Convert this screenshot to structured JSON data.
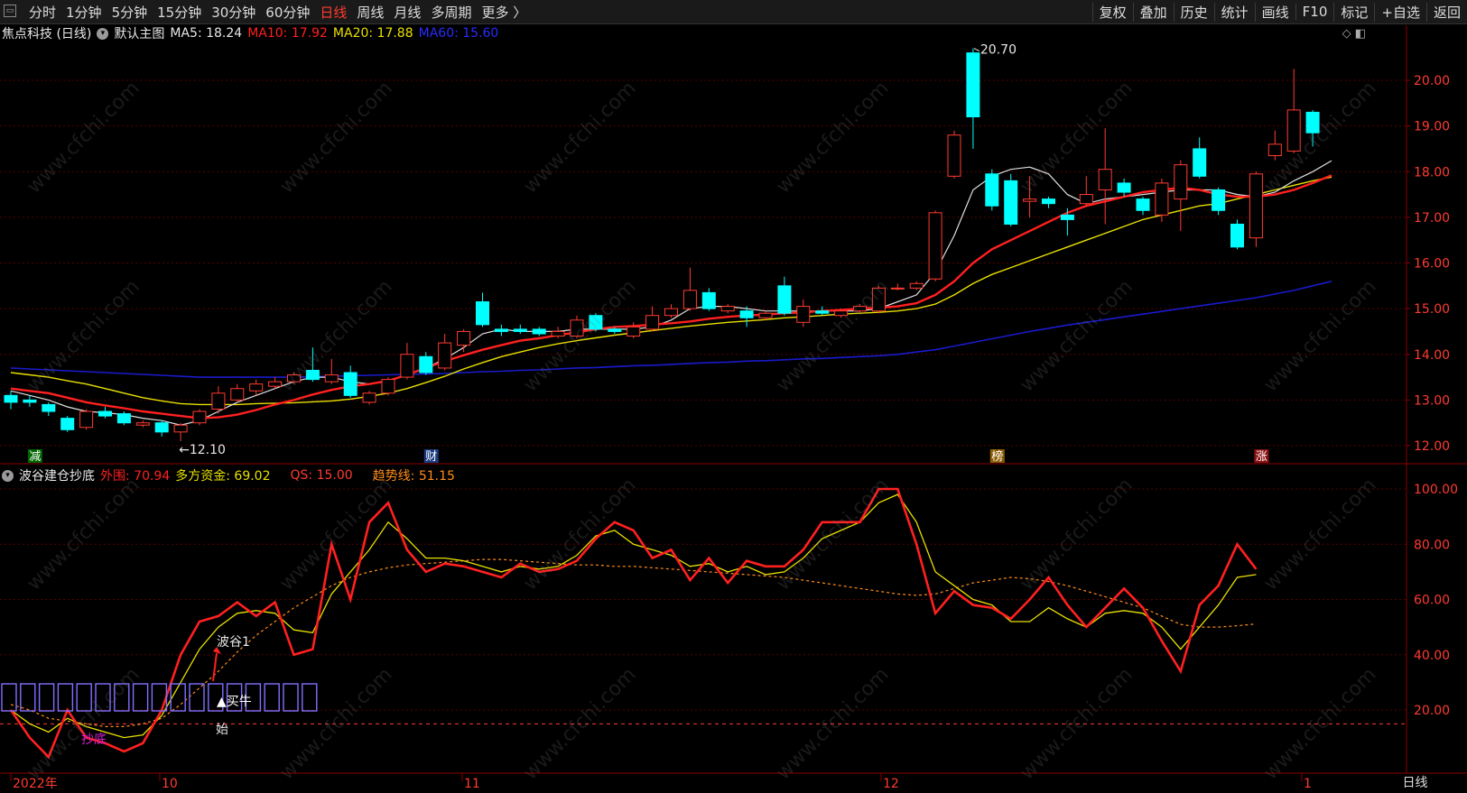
{
  "toolbar": {
    "window_icon": "window-icon",
    "periods": [
      "分时",
      "1分钟",
      "5分钟",
      "15分钟",
      "30分钟",
      "60分钟",
      "日线",
      "周线",
      "月线",
      "多周期",
      "更多 〉"
    ],
    "active_period": "日线",
    "right_tools": [
      "复权",
      "叠加",
      "历史",
      "统计",
      "画线",
      "F10",
      "标记",
      "+自选",
      "返回"
    ]
  },
  "main_chart": {
    "stock_title": "焦点科技 (日线)",
    "template_label": "默认主图",
    "ma5_label": "MA5: 18.24",
    "ma10_label": "MA10: 17.92",
    "ma20_label": "MA20: 17.88",
    "ma60_label": "MA60: 15.60",
    "high_annotation": "20.70",
    "low_annotation": "←12.10",
    "y_ticks": [
      "20.00",
      "19.00",
      "18.00",
      "17.00",
      "16.00",
      "15.00",
      "14.00",
      "13.00",
      "12.00"
    ],
    "event_markers": [
      "减",
      "财",
      "榜",
      "涨"
    ]
  },
  "sub_chart": {
    "indicator_name": "波谷建仓抄底",
    "waiwei_label": "外围: 70.94",
    "duofang_label": "多方资金: 69.02",
    "qs_label": "QS: 15.00",
    "trend_label": "趋势线: 51.15",
    "y_ticks": [
      "100.00",
      "80.00",
      "60.00",
      "40.00",
      "20.00"
    ],
    "annotations": {
      "bogu": "波谷1",
      "buy": "▲买牛",
      "start": "始",
      "chaodi": "抄底"
    }
  },
  "x_axis": {
    "labels": [
      "2022年",
      "10",
      "11",
      "12",
      "1"
    ],
    "period_label": "日线"
  },
  "watermark": "www.cfchi.com",
  "colors": {
    "up": "#ff3b30",
    "down": "#00ffff",
    "ma5": "#e0e0e0",
    "ma10": "#ff2020",
    "ma20": "#e8e000",
    "ma60": "#1a1acc",
    "qs": "#ff3b30",
    "trend": "#ff8c1a"
  },
  "chart_data": [
    {
      "type": "candlestick",
      "title": "焦点科技 (日线)",
      "ylim": [
        11.7,
        21.0
      ],
      "candles": [
        {
          "o": 13.1,
          "c": 12.95,
          "h": 13.2,
          "l": 12.8
        },
        {
          "o": 13.0,
          "c": 12.95,
          "h": 13.1,
          "l": 12.85
        },
        {
          "o": 12.9,
          "c": 12.75,
          "h": 12.95,
          "l": 12.65
        },
        {
          "o": 12.6,
          "c": 12.35,
          "h": 12.65,
          "l": 12.3
        },
        {
          "o": 12.4,
          "c": 12.75,
          "h": 12.8,
          "l": 12.35
        },
        {
          "o": 12.75,
          "c": 12.65,
          "h": 12.85,
          "l": 12.6
        },
        {
          "o": 12.7,
          "c": 12.5,
          "h": 12.75,
          "l": 12.45
        },
        {
          "o": 12.45,
          "c": 12.5,
          "h": 12.55,
          "l": 12.4
        },
        {
          "o": 12.5,
          "c": 12.3,
          "h": 12.55,
          "l": 12.2
        },
        {
          "o": 12.3,
          "c": 12.45,
          "h": 12.5,
          "l": 12.1
        },
        {
          "o": 12.5,
          "c": 12.75,
          "h": 12.8,
          "l": 12.45
        },
        {
          "o": 12.8,
          "c": 13.15,
          "h": 13.3,
          "l": 12.7
        },
        {
          "o": 13.0,
          "c": 13.25,
          "h": 13.35,
          "l": 12.95
        },
        {
          "o": 13.2,
          "c": 13.35,
          "h": 13.45,
          "l": 13.1
        },
        {
          "o": 13.3,
          "c": 13.4,
          "h": 13.5,
          "l": 13.25
        },
        {
          "o": 13.4,
          "c": 13.55,
          "h": 13.6,
          "l": 13.35
        },
        {
          "o": 13.65,
          "c": 13.45,
          "h": 14.15,
          "l": 13.4
        },
        {
          "o": 13.4,
          "c": 13.55,
          "h": 13.9,
          "l": 13.35
        },
        {
          "o": 13.6,
          "c": 13.1,
          "h": 13.75,
          "l": 13.05
        },
        {
          "o": 12.95,
          "c": 13.15,
          "h": 13.2,
          "l": 12.9
        },
        {
          "o": 13.15,
          "c": 13.45,
          "h": 13.5,
          "l": 13.1
        },
        {
          "o": 13.5,
          "c": 14.0,
          "h": 14.25,
          "l": 13.45
        },
        {
          "o": 13.95,
          "c": 13.6,
          "h": 14.05,
          "l": 13.55
        },
        {
          "o": 13.7,
          "c": 14.25,
          "h": 14.45,
          "l": 13.65
        },
        {
          "o": 14.2,
          "c": 14.5,
          "h": 14.55,
          "l": 14.05
        },
        {
          "o": 15.15,
          "c": 14.65,
          "h": 15.35,
          "l": 14.6
        },
        {
          "o": 14.55,
          "c": 14.5,
          "h": 14.65,
          "l": 14.4
        },
        {
          "o": 14.55,
          "c": 14.5,
          "h": 14.65,
          "l": 14.45
        },
        {
          "o": 14.55,
          "c": 14.45,
          "h": 14.6,
          "l": 14.4
        },
        {
          "o": 14.4,
          "c": 14.5,
          "h": 14.6,
          "l": 14.35
        },
        {
          "o": 14.4,
          "c": 14.75,
          "h": 14.85,
          "l": 14.35
        },
        {
          "o": 14.85,
          "c": 14.55,
          "h": 14.9,
          "l": 14.5
        },
        {
          "o": 14.55,
          "c": 14.5,
          "h": 14.6,
          "l": 14.45
        },
        {
          "o": 14.4,
          "c": 14.6,
          "h": 14.7,
          "l": 14.35
        },
        {
          "o": 14.55,
          "c": 14.85,
          "h": 15.05,
          "l": 14.5
        },
        {
          "o": 14.85,
          "c": 15.0,
          "h": 15.1,
          "l": 14.8
        },
        {
          "o": 15.0,
          "c": 15.4,
          "h": 15.9,
          "l": 14.95
        },
        {
          "o": 15.35,
          "c": 15.0,
          "h": 15.45,
          "l": 14.95
        },
        {
          "o": 14.95,
          "c": 15.05,
          "h": 15.1,
          "l": 14.9
        },
        {
          "o": 14.95,
          "c": 14.8,
          "h": 15.05,
          "l": 14.6
        },
        {
          "o": 14.8,
          "c": 14.9,
          "h": 14.95,
          "l": 14.75
        },
        {
          "o": 15.5,
          "c": 14.9,
          "h": 15.7,
          "l": 14.85
        },
        {
          "o": 14.7,
          "c": 15.05,
          "h": 15.2,
          "l": 14.6
        },
        {
          "o": 14.95,
          "c": 14.9,
          "h": 15.05,
          "l": 14.85
        },
        {
          "o": 14.85,
          "c": 14.95,
          "h": 15.0,
          "l": 14.8
        },
        {
          "o": 14.95,
          "c": 15.05,
          "h": 15.1,
          "l": 14.9
        },
        {
          "o": 14.95,
          "c": 15.45,
          "h": 15.5,
          "l": 14.9
        },
        {
          "o": 15.45,
          "c": 15.45,
          "h": 15.55,
          "l": 15.4
        },
        {
          "o": 15.45,
          "c": 15.55,
          "h": 15.6,
          "l": 15.4
        },
        {
          "o": 15.65,
          "c": 17.1,
          "h": 17.15,
          "l": 15.6
        },
        {
          "o": 17.9,
          "c": 18.8,
          "h": 18.9,
          "l": 17.85
        },
        {
          "o": 20.6,
          "c": 19.2,
          "h": 20.7,
          "l": 18.5
        },
        {
          "o": 17.95,
          "c": 17.25,
          "h": 18.05,
          "l": 17.15
        },
        {
          "o": 17.8,
          "c": 16.85,
          "h": 17.95,
          "l": 16.8
        },
        {
          "o": 17.35,
          "c": 17.4,
          "h": 17.9,
          "l": 17.0
        },
        {
          "o": 17.4,
          "c": 17.3,
          "h": 17.45,
          "l": 17.2
        },
        {
          "o": 17.05,
          "c": 16.95,
          "h": 17.2,
          "l": 16.6
        },
        {
          "o": 17.3,
          "c": 17.5,
          "h": 17.9,
          "l": 17.25
        },
        {
          "o": 17.6,
          "c": 18.05,
          "h": 18.95,
          "l": 16.85
        },
        {
          "o": 17.75,
          "c": 17.55,
          "h": 17.85,
          "l": 17.45
        },
        {
          "o": 17.4,
          "c": 17.15,
          "h": 17.45,
          "l": 17.05
        },
        {
          "o": 17.05,
          "c": 17.75,
          "h": 17.85,
          "l": 16.9
        },
        {
          "o": 17.4,
          "c": 18.15,
          "h": 18.25,
          "l": 16.7
        },
        {
          "o": 18.5,
          "c": 17.9,
          "h": 18.75,
          "l": 17.85
        },
        {
          "o": 17.6,
          "c": 17.15,
          "h": 17.65,
          "l": 17.05
        },
        {
          "o": 16.85,
          "c": 16.35,
          "h": 16.95,
          "l": 16.3
        },
        {
          "o": 16.55,
          "c": 17.95,
          "h": 18.0,
          "l": 16.35
        },
        {
          "o": 18.35,
          "c": 18.6,
          "h": 18.9,
          "l": 18.25
        },
        {
          "o": 18.45,
          "c": 19.35,
          "h": 20.25,
          "l": 18.4
        },
        {
          "o": 19.3,
          "c": 18.85,
          "h": 19.35,
          "l": 18.55
        }
      ],
      "series": [
        {
          "name": "MA5",
          "values": [
            13.2,
            13.1,
            13.0,
            12.85,
            12.75,
            12.72,
            12.68,
            12.6,
            12.55,
            12.45,
            12.55,
            12.75,
            12.95,
            13.1,
            13.25,
            13.4,
            13.5,
            13.5,
            13.4,
            13.35,
            13.4,
            13.55,
            13.7,
            13.9,
            14.15,
            14.45,
            14.55,
            14.5,
            14.5,
            14.5,
            14.55,
            14.55,
            14.55,
            14.55,
            14.6,
            14.75,
            15.0,
            15.05,
            15.05,
            15.0,
            14.95,
            14.95,
            14.95,
            14.95,
            14.95,
            14.95,
            15.0,
            15.15,
            15.3,
            15.8,
            16.6,
            17.6,
            17.9,
            18.05,
            18.1,
            17.95,
            17.5,
            17.3,
            17.4,
            17.45,
            17.5,
            17.55,
            17.6,
            17.6,
            17.6,
            17.5,
            17.45,
            17.55,
            17.8,
            18.0,
            18.24
          ]
        },
        {
          "name": "MA10",
          "values": [
            13.25,
            13.2,
            13.15,
            13.05,
            12.95,
            12.88,
            12.82,
            12.75,
            12.7,
            12.65,
            12.6,
            12.62,
            12.68,
            12.78,
            12.9,
            13.0,
            13.12,
            13.22,
            13.3,
            13.35,
            13.42,
            13.55,
            13.7,
            13.85,
            13.98,
            14.1,
            14.2,
            14.3,
            14.35,
            14.42,
            14.48,
            14.55,
            14.6,
            14.62,
            14.65,
            14.68,
            14.72,
            14.78,
            14.82,
            14.85,
            14.87,
            14.9,
            14.92,
            14.95,
            14.97,
            15.0,
            15.02,
            15.05,
            15.12,
            15.3,
            15.6,
            16.0,
            16.3,
            16.5,
            16.7,
            16.9,
            17.1,
            17.25,
            17.35,
            17.45,
            17.55,
            17.6,
            17.65,
            17.6,
            17.5,
            17.45,
            17.45,
            17.5,
            17.6,
            17.75,
            17.92
          ]
        },
        {
          "name": "MA20",
          "values": [
            13.6,
            13.55,
            13.5,
            13.42,
            13.35,
            13.25,
            13.15,
            13.05,
            12.98,
            12.92,
            12.9,
            12.9,
            12.9,
            12.92,
            12.93,
            12.94,
            12.96,
            12.98,
            13.02,
            13.08,
            13.15,
            13.25,
            13.38,
            13.52,
            13.68,
            13.82,
            13.95,
            14.05,
            14.15,
            14.23,
            14.3,
            14.36,
            14.42,
            14.47,
            14.52,
            14.57,
            14.62,
            14.66,
            14.7,
            14.73,
            14.76,
            14.8,
            14.82,
            14.85,
            14.88,
            14.9,
            14.92,
            14.95,
            15.0,
            15.1,
            15.3,
            15.55,
            15.75,
            15.9,
            16.05,
            16.2,
            16.35,
            16.5,
            16.65,
            16.8,
            16.95,
            17.05,
            17.15,
            17.25,
            17.3,
            17.4,
            17.5,
            17.6,
            17.7,
            17.8,
            17.88
          ]
        },
        {
          "name": "MA60",
          "values": [
            13.7,
            13.68,
            13.66,
            13.64,
            13.62,
            13.6,
            13.58,
            13.56,
            13.54,
            13.52,
            13.5,
            13.5,
            13.5,
            13.5,
            13.5,
            13.5,
            13.51,
            13.52,
            13.53,
            13.54,
            13.55,
            13.56,
            13.57,
            13.58,
            13.6,
            13.62,
            13.63,
            13.65,
            13.66,
            13.68,
            13.7,
            13.71,
            13.73,
            13.75,
            13.76,
            13.78,
            13.8,
            13.82,
            13.83,
            13.85,
            13.86,
            13.88,
            13.9,
            13.91,
            13.93,
            13.95,
            13.97,
            14.0,
            14.05,
            14.1,
            14.18,
            14.26,
            14.34,
            14.42,
            14.5,
            14.57,
            14.64,
            14.7,
            14.76,
            14.82,
            14.88,
            14.94,
            15.0,
            15.06,
            15.12,
            15.18,
            15.24,
            15.32,
            15.4,
            15.5,
            15.6
          ]
        }
      ]
    },
    {
      "type": "line",
      "title": "波谷建仓抄底",
      "ylim": [
        0,
        103
      ],
      "series": [
        {
          "name": "外围",
          "values": [
            20,
            10,
            3,
            20,
            10,
            8,
            5,
            8,
            20,
            40,
            52,
            54,
            59,
            54,
            59,
            40,
            42,
            80,
            60,
            88,
            95,
            78,
            70,
            73,
            72,
            70,
            68,
            73,
            70,
            71,
            74,
            82,
            88,
            85,
            75,
            78,
            67,
            75,
            66,
            74,
            72,
            72,
            78,
            88,
            88,
            88,
            100,
            100,
            80,
            55,
            63,
            58,
            57,
            53,
            60,
            68,
            58,
            50,
            57,
            64,
            57,
            45,
            34,
            58,
            65,
            80,
            71
          ]
        },
        {
          "name": "多方资金",
          "values": [
            20,
            15,
            12,
            17,
            14,
            12,
            10,
            11,
            18,
            30,
            42,
            50,
            55,
            56,
            55,
            49,
            48,
            62,
            70,
            78,
            88,
            82,
            75,
            75,
            74,
            72,
            70,
            72,
            71,
            72,
            76,
            83,
            85,
            80,
            78,
            76,
            72,
            73,
            70,
            72,
            69,
            70,
            75,
            82,
            85,
            88,
            95,
            98,
            88,
            70,
            65,
            60,
            58,
            52,
            52,
            57,
            53,
            50,
            55,
            56,
            55,
            50,
            42,
            50,
            58,
            68,
            69.02
          ]
        },
        {
          "name": "QS",
          "values": [
            15,
            15,
            15,
            15,
            15,
            15,
            15,
            15,
            15,
            15,
            15,
            15,
            15,
            15,
            15,
            15,
            15,
            15,
            15,
            15,
            15,
            15,
            15,
            15,
            15,
            15,
            15,
            15,
            15,
            15,
            15,
            15,
            15,
            15,
            15,
            15,
            15,
            15,
            15,
            15,
            15,
            15,
            15,
            15,
            15,
            15,
            15,
            15,
            15,
            15,
            15,
            15,
            15,
            15,
            15,
            15,
            15,
            15,
            15,
            15,
            15,
            15,
            15,
            15,
            15,
            15,
            15
          ]
        },
        {
          "name": "趋势线",
          "values": [
            22,
            20,
            17,
            16,
            15,
            14,
            14,
            15,
            17,
            22,
            28,
            34,
            41,
            47,
            52,
            57,
            61,
            65,
            68,
            70,
            71.5,
            72.5,
            73,
            73.5,
            74,
            74.5,
            74.5,
            74,
            73.5,
            73,
            72.5,
            72.5,
            72,
            72,
            71.5,
            71,
            70.5,
            70,
            69.5,
            69,
            68.5,
            68,
            67,
            66,
            65,
            64,
            63,
            62,
            61.5,
            62,
            64,
            66,
            67,
            68,
            67.5,
            66.5,
            65,
            63,
            61,
            59,
            57,
            54,
            51,
            50,
            50,
            50.5,
            51.15
          ]
        }
      ]
    }
  ]
}
